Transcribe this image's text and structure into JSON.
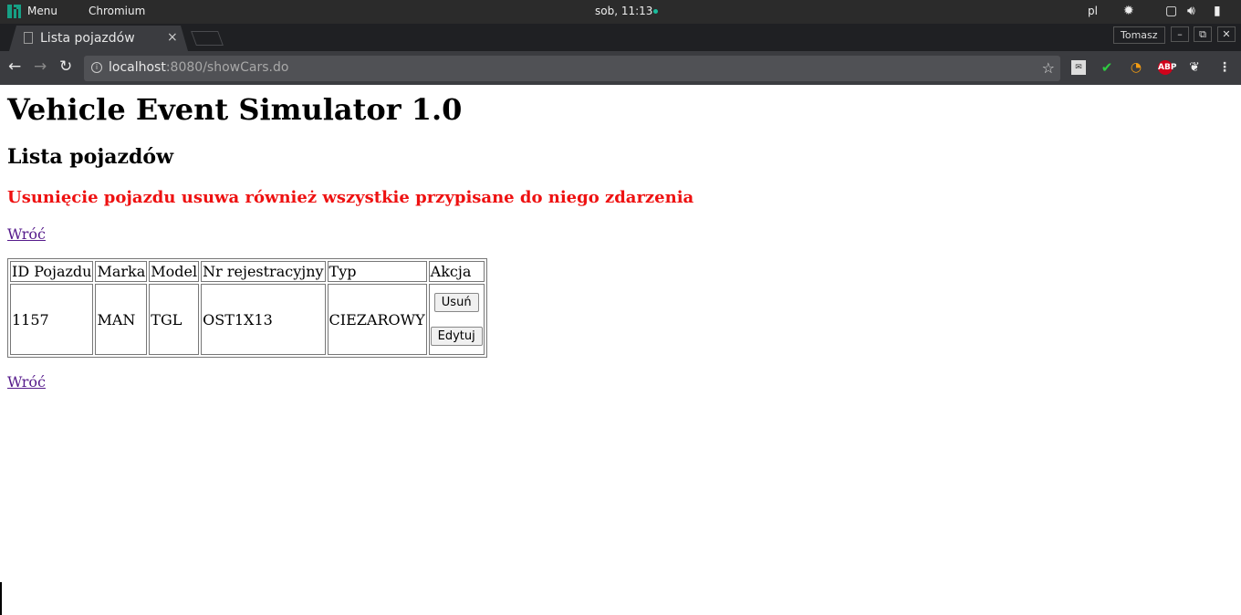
{
  "system_bar": {
    "menu_label": "Menu",
    "app_label": "Chromium",
    "clock": "sob, 11:13",
    "keyboard_layout": "pl",
    "accent_color": "#16a085"
  },
  "browser": {
    "tab": {
      "title": "Lista pojazdów",
      "close_glyph": "×"
    },
    "profile_name": "Tomasz",
    "window_buttons": {
      "minimize": "–",
      "restore": "⧉",
      "close": "✕"
    },
    "nav": {
      "back": "←",
      "forward": "→",
      "reload": "↻"
    },
    "url_host": "localhost",
    "url_rest": ":8080/showCars.do",
    "extensions": [
      "mail-checker-icon",
      "tick-icon",
      "rss-icon",
      "adblock-icon",
      "gnome-icon"
    ],
    "adblock_label": "ABP"
  },
  "page": {
    "title": "Vehicle Event Simulator 1.0",
    "subtitle": "Lista pojazdów",
    "warning": "Usunięcie pojazdu usuwa również wszystkie przypisane do niego zdarzenia",
    "back_link_top": "Wróć",
    "back_link_bottom": "Wróć",
    "table": {
      "headers": [
        "ID Pojazdu",
        "Marka",
        "Model",
        "Nr rejestracyjny",
        "Typ",
        "Akcja"
      ],
      "rows": [
        {
          "id": "1157",
          "make": "MAN",
          "model": "TGL",
          "plate": "OST1X13",
          "type": "CIEZAROWY",
          "delete_label": "Usuń",
          "edit_label": "Edytuj"
        }
      ]
    }
  }
}
